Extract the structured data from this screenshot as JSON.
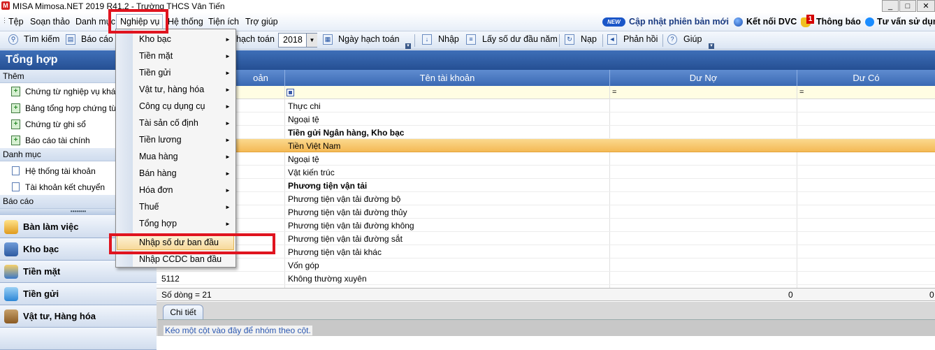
{
  "window": {
    "title": "MISA Mimosa.NET 2019 R41.2 - Trường THCS Vân Tiến",
    "controls": [
      "_",
      "□",
      "✕"
    ]
  },
  "menubar": {
    "items": [
      "Tệp",
      "Soạn thảo",
      "Danh mục",
      "Nghiệp vụ",
      "Hệ thống",
      "Tiện ích",
      "Trợ giúp"
    ],
    "new_badge": "NEW",
    "update_link": "Cập nhật phiên bản mới",
    "dvc_link": "Kết nối DVC",
    "notify_count": "1",
    "notify_link": "Thông báo",
    "consult_link": "Tư vấn sử dụng"
  },
  "toolbar": {
    "search": "Tìm kiếm",
    "report": "Báo cáo",
    "accounting_year_label": "hạch toán",
    "year": "2018",
    "accounting_date": "Ngày hạch toán",
    "import": "Nhập",
    "opening_balance": "Lấy số dư đầu năm",
    "load": "Nạp",
    "feedback": "Phản hồi",
    "help": "Giúp"
  },
  "sidebar": {
    "title": "Tổng hợp",
    "groups": [
      {
        "label": "Thêm",
        "items": [
          "Chứng từ nghiệp vụ khác",
          "Bảng tổng hợp chứng từ cù",
          "Chứng từ ghi sổ",
          "Báo cáo tài chính"
        ]
      },
      {
        "label": "Danh mục",
        "items": [
          "Hệ thống tài khoản",
          "Tài khoản kết chuyển"
        ]
      },
      {
        "label": "Báo cáo",
        "items": []
      }
    ],
    "nav": [
      "Bàn làm việc",
      "Kho bạc",
      "Tiền mặt",
      "Tiền gửi",
      "Vật tư, Hàng hóa"
    ]
  },
  "content": {
    "title_fragment": "u",
    "columns": [
      "oản",
      "Tên tài khoản",
      "Dư Nợ",
      "Dư Có"
    ],
    "filter_symbol": "=",
    "rows": [
      {
        "code": "",
        "name": "Thực chi",
        "bold": false
      },
      {
        "code": "",
        "name": "Ngoại tệ",
        "bold": false
      },
      {
        "code": "",
        "name": "Tiền gửi Ngân hàng, Kho bạc",
        "bold": true
      },
      {
        "code": "",
        "name": "Tiền Việt Nam",
        "bold": false,
        "selected": true
      },
      {
        "code": "",
        "name": "Ngoại tệ",
        "bold": false
      },
      {
        "code": "",
        "name": "Vật kiến trúc",
        "bold": false
      },
      {
        "code": "",
        "name": "Phương tiện vận tải",
        "bold": true
      },
      {
        "code": "",
        "name": "Phương tiện vận tải đường bộ",
        "bold": false
      },
      {
        "code": "",
        "name": "Phương tiện vận tải đường thủy",
        "bold": false
      },
      {
        "code": "",
        "name": "Phương tiện vận tải đường không",
        "bold": false
      },
      {
        "code": "",
        "name": "Phương tiện vận tải đường sắt",
        "bold": false
      },
      {
        "code": "",
        "name": "Phương tiện vận tải khác",
        "bold": false
      },
      {
        "code": "",
        "name": "Vốn góp",
        "bold": false
      },
      {
        "code": "5112",
        "name": "Không thường xuyên",
        "bold": false
      }
    ],
    "footer": {
      "row_count": "Số dòng = 21",
      "debit_total": "0",
      "credit_total": "0"
    },
    "detail_tab": "Chi tiết",
    "group_hint": "Kéo một cột vào đây để nhóm theo cột."
  },
  "dropdown": {
    "items": [
      {
        "label": "Kho bạc",
        "submenu": true
      },
      {
        "label": "Tiền mặt",
        "submenu": true
      },
      {
        "label": "Tiền gửi",
        "submenu": true
      },
      {
        "label": "Vật tư, hàng hóa",
        "submenu": true
      },
      {
        "label": "Công cụ dụng cụ",
        "submenu": true
      },
      {
        "label": "Tài sản cố định",
        "submenu": true
      },
      {
        "label": "Tiền lương",
        "submenu": true
      },
      {
        "label": "Mua hàng",
        "submenu": true
      },
      {
        "label": "Bán hàng",
        "submenu": true
      },
      {
        "label": "Hóa đơn",
        "submenu": true
      },
      {
        "label": "Thuế",
        "submenu": true
      },
      {
        "label": "Tổng hợp",
        "submenu": true
      },
      {
        "label": "Nhập số dư ban đầu",
        "submenu": false,
        "highlighted": true
      },
      {
        "label": "Nhập CCDC ban đầu",
        "submenu": false
      }
    ]
  },
  "colors": {
    "header_blue": "#2b5aa3",
    "selection_orange": "#f6c76b",
    "annotation_red": "#e0141f"
  }
}
